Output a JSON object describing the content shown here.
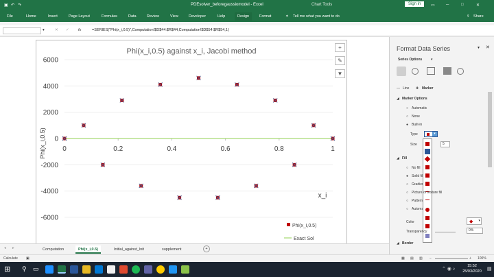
{
  "titlebar": {
    "title": "PDEsolver_beforegaussiomodel - Excel",
    "context": "Chart Tools",
    "signin": "Sign in"
  },
  "menu": {
    "items": [
      "File",
      "Home",
      "Insert",
      "Page Layout",
      "Formulas",
      "Data",
      "Review",
      "View",
      "Developer",
      "Help",
      "Design",
      "Format"
    ],
    "tell_me": "Tell me what you want to do",
    "share": "Share"
  },
  "formula_bar": {
    "fx": "fx",
    "formula": "=SERIES(\"Phi(x_i,0.5)\",Computation!$D$44:$R$44,Computation!$D$54:$R$54,1)"
  },
  "chart": {
    "title": "Phi(x_i,0.5) against x_i, Jacobi method",
    "ylabel": "Phi(x_i,0.5)",
    "xlabel": "x_i",
    "y_ticks": [
      "6000",
      "4000",
      "2000",
      "0",
      "-2000",
      "-4000",
      "-6000"
    ],
    "x_ticks": [
      "0",
      "0.2",
      "0.4",
      "0.6",
      "0.8",
      "1"
    ],
    "legend": {
      "marker_series": "Phi(x_i,0.5)",
      "line_series": "Exact Sol"
    }
  },
  "chart_data": {
    "type": "scatter",
    "title": "Phi(x_i,0.5) against x_i, Jacobi method",
    "xlabel": "x_i",
    "ylabel": "Phi(x_i,0.5)",
    "xlim": [
      0,
      1
    ],
    "ylim": [
      -6000,
      6000
    ],
    "x_ticks": [
      0,
      0.2,
      0.4,
      0.6,
      0.8,
      1
    ],
    "y_ticks": [
      -6000,
      -4000,
      -2000,
      0,
      2000,
      4000,
      6000
    ],
    "legend_position": "bottom-right",
    "series": [
      {
        "name": "Phi(x_i,0.5)",
        "x": [
          0,
          0.0714,
          0.1429,
          0.2143,
          0.2857,
          0.3571,
          0.4286,
          0.5,
          0.5714,
          0.6429,
          0.7143,
          0.7857,
          0.8571,
          0.9286,
          1
        ],
        "y": [
          0,
          1000,
          -2000,
          2900,
          -3600,
          4100,
          -4500,
          4600,
          -4500,
          4100,
          -3600,
          2900,
          -2000,
          1000,
          0
        ],
        "color": "#c00000"
      },
      {
        "name": "Exact Sol",
        "x": [
          0,
          1
        ],
        "y": [
          0,
          0
        ],
        "color": "#92d050"
      }
    ]
  },
  "format_pane": {
    "title": "Format Data Series",
    "options": "Series Options",
    "tabs": [
      "Line",
      "Marker"
    ],
    "section_marker_options": "Marker Options",
    "radio_automatic": "Automatic",
    "radio_none": "None",
    "radio_builtin": "Built-in",
    "type_label": "Type",
    "size_label": "Size",
    "size_value": "5",
    "section_fill": "Fill",
    "fill_options": [
      "No fill",
      "Solid fill",
      "Gradient fill",
      "Picture or texture fill",
      "Pattern fill",
      "Automatic"
    ],
    "color_label": "Color",
    "transparency_label": "Transparency",
    "transparency_value": "0%",
    "section_border": "Border"
  },
  "sheet_tabs": [
    "Computation",
    "Phi(x_i,0.5)",
    "Initial_against_Init",
    "supplement"
  ],
  "status": {
    "left": "Calculate",
    "zoom": "100%"
  },
  "taskbar": {
    "time": "15:52",
    "date": "25/03/2020"
  },
  "colors": {
    "excel_green": "#217346",
    "marker_red": "#c00000",
    "line_green": "#92d050"
  }
}
